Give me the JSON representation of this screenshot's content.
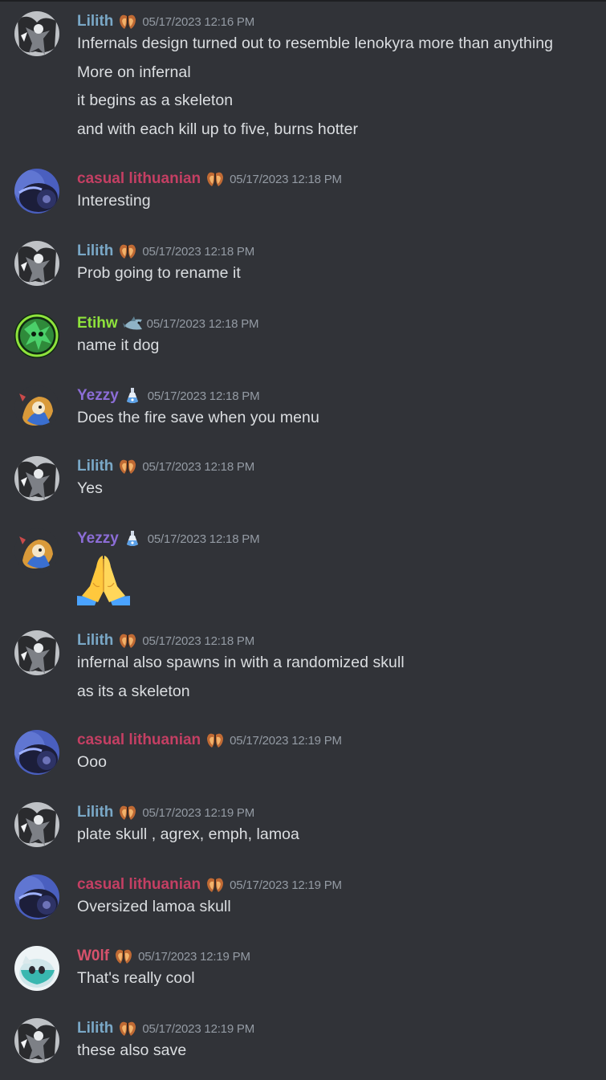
{
  "colors": {
    "background": "#313338",
    "lilith": "#7aa8c7",
    "casual": "#c43f63",
    "etihw": "#8fe33c",
    "yezzy": "#8c6dd6",
    "w0lf": "#d7526c",
    "timestamp": "#949ba4",
    "text": "#dbdee1"
  },
  "messages": [
    {
      "author": "Lilith",
      "badge": "moth-wings-icon",
      "time": "05/17/2023 12:16 PM",
      "lines": [
        "Infernals design turned out to resemble lenokyra more than anything",
        "More on infernal",
        "it begins as a skeleton",
        "and with each kill up to five, burns hotter"
      ]
    },
    {
      "author": "casual lithuanian",
      "badge": "moth-wings-icon",
      "time": "05/17/2023 12:18 PM",
      "lines": [
        "Interesting"
      ]
    },
    {
      "author": "Lilith",
      "badge": "moth-wings-icon",
      "time": "05/17/2023 12:18 PM",
      "lines": [
        "Prob going to rename it"
      ]
    },
    {
      "author": "Etihw",
      "badge": "shark-icon",
      "time": "05/17/2023 12:18 PM",
      "lines": [
        "name it dog"
      ]
    },
    {
      "author": "Yezzy",
      "badge": "potion-icon",
      "time": "05/17/2023 12:18 PM",
      "lines": [
        "Does the fire save when you menu"
      ]
    },
    {
      "author": "Lilith",
      "badge": "moth-wings-icon",
      "time": "05/17/2023 12:18 PM",
      "lines": [
        "Yes"
      ]
    },
    {
      "author": "Yezzy",
      "badge": "potion-icon",
      "time": "05/17/2023 12:18 PM",
      "lines": [],
      "emoji": "folded-hands-icon"
    },
    {
      "author": "Lilith",
      "badge": "moth-wings-icon",
      "time": "05/17/2023 12:18 PM",
      "lines": [
        "infernal also spawns in with a randomized skull",
        "as its a skeleton"
      ]
    },
    {
      "author": "casual lithuanian",
      "badge": "moth-wings-icon",
      "time": "05/17/2023 12:19 PM",
      "lines": [
        "Ooo"
      ]
    },
    {
      "author": "Lilith",
      "badge": "moth-wings-icon",
      "time": "05/17/2023 12:19 PM",
      "lines": [
        "plate skull , agrex, emph, lamoa"
      ]
    },
    {
      "author": "casual lithuanian",
      "badge": "moth-wings-icon",
      "time": "05/17/2023 12:19 PM",
      "lines": [
        "Oversized lamoa skull"
      ]
    },
    {
      "author": "W0lf",
      "badge": "moth-wings-icon",
      "time": "05/17/2023 12:19 PM",
      "lines": [
        "That's really cool"
      ]
    },
    {
      "author": "Lilith",
      "badge": "moth-wings-icon",
      "time": "05/17/2023 12:19 PM",
      "lines": [
        "these also save"
      ]
    }
  ]
}
